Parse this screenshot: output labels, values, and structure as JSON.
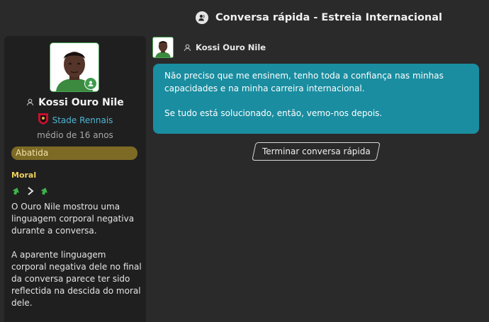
{
  "header": {
    "title": "Conversa rápida - Estreia Internacional",
    "icon": "chat-person-icon"
  },
  "player": {
    "name": "Kossi Ouro Nile",
    "club": "Stade Rennais",
    "age_text": "médio de 16 anos",
    "mood": "Abatida"
  },
  "morale": {
    "label": "Moral",
    "from": "up-arrow-green",
    "to": "up-arrow-green"
  },
  "sidebar_text": [
    "O Ouro Nile mostrou uma linguagem corporal negativa durante a conversa.",
    "A aparente linguagem corporal negativa dele no final da conversa parece ter sido reflectida na descida do moral dele."
  ],
  "message": {
    "sender": "Kossi Ouro Nile",
    "paragraphs": [
      "Não preciso que me ensinem, tenho toda a confiança nas minhas capacidades e na minha carreira internacional.",
      "Se tudo está solucionado, então, vemo-nos depois."
    ]
  },
  "end_button": "Terminar conversa rápida",
  "colors": {
    "accent_teal": "#1a8da0",
    "club_link": "#4fb6d2",
    "mood_badge": "#7d6a25",
    "morale_label": "#f0d35a"
  }
}
